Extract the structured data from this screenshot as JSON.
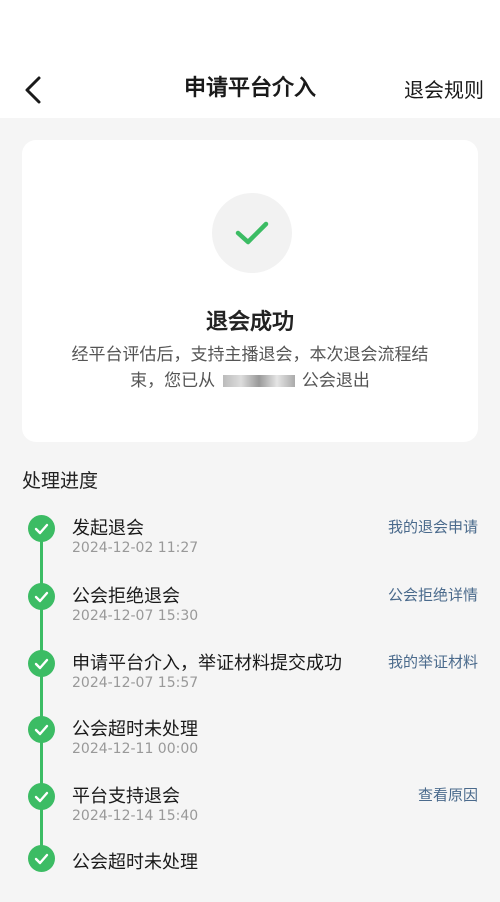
{
  "header": {
    "title": "申请平台介入",
    "rules_link": "退会规则"
  },
  "result": {
    "title": "退会成功",
    "desc_line1": "经平台评估后，支持主播退会，本次退会流程结",
    "desc_line2_prefix": "束，您已从",
    "desc_line2_suffix": "公会退出"
  },
  "progress": {
    "title": "处理进度",
    "steps": [
      {
        "title": "发起退会",
        "time": "2024-12-02 11:27",
        "link": "我的退会申请"
      },
      {
        "title": "公会拒绝退会",
        "time": "2024-12-07 15:30",
        "link": "公会拒绝详情"
      },
      {
        "title": "申请平台介入，举证材料提交成功",
        "time": "2024-12-07 15:57",
        "link": "我的举证材料"
      },
      {
        "title": "公会超时未处理",
        "time": "2024-12-11 00:00",
        "link": ""
      },
      {
        "title": "平台支持退会",
        "time": "2024-12-14 15:40",
        "link": "查看原因"
      },
      {
        "title": "公会超时未处理",
        "time": "",
        "link": ""
      }
    ]
  },
  "colors": {
    "accent_green": "#3cbc64",
    "link_blue": "#4a6a8c"
  }
}
